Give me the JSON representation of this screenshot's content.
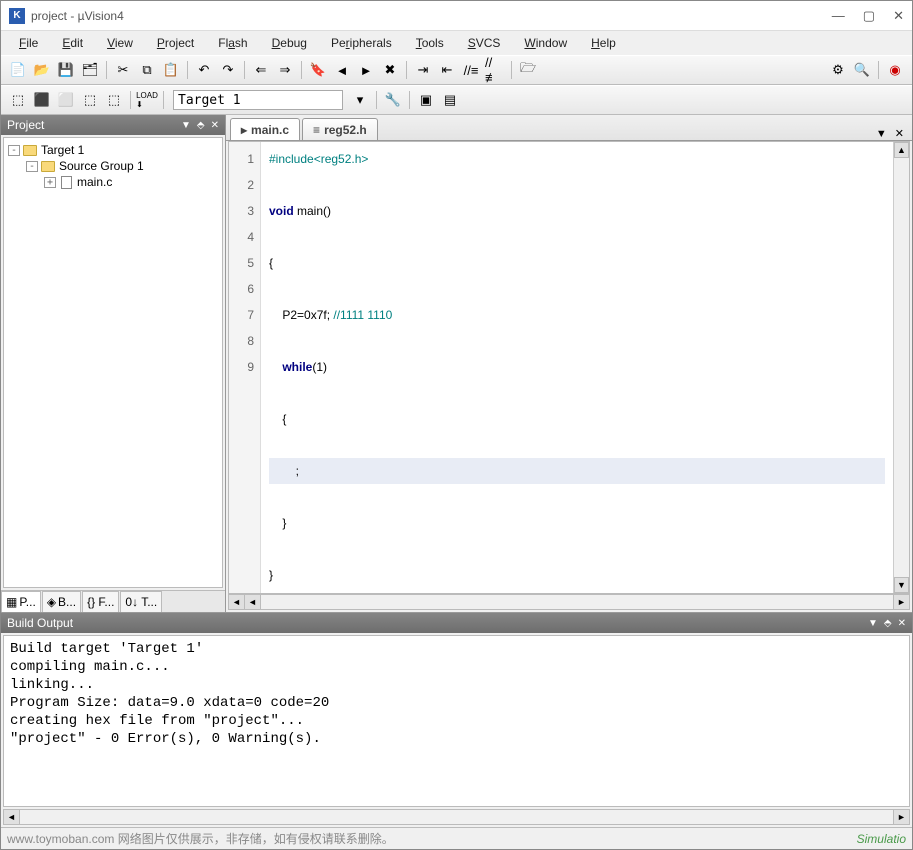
{
  "window": {
    "app_icon": "K",
    "title": "project  - µVision4"
  },
  "menu": [
    "File",
    "Edit",
    "View",
    "Project",
    "Flash",
    "Debug",
    "Peripherals",
    "Tools",
    "SVCS",
    "Window",
    "Help"
  ],
  "toolbar2": {
    "target": "Target 1"
  },
  "project_panel": {
    "title": "Project",
    "tree": {
      "root": "Target 1",
      "group": "Source Group 1",
      "file": "main.c"
    },
    "bottom_tabs": [
      "P...",
      "B...",
      "{} F...",
      "0↓ T..."
    ]
  },
  "editor": {
    "tabs": [
      "main.c",
      "reg52.h"
    ],
    "active_tab": 0,
    "highlighted_line": 7,
    "lines": [
      {
        "n": 1,
        "raw": "#include<reg52.h>",
        "type": "pp"
      },
      {
        "n": 2,
        "raw": "void main()",
        "type": "kw_void_main"
      },
      {
        "n": 3,
        "raw": "{",
        "type": "plain"
      },
      {
        "n": 4,
        "raw": "    P2=0x7f; //1111 1110",
        "type": "assign_comment"
      },
      {
        "n": 5,
        "raw": "    while(1)",
        "type": "kw_while"
      },
      {
        "n": 6,
        "raw": "    {",
        "type": "plain"
      },
      {
        "n": 7,
        "raw": "        ;",
        "type": "plain"
      },
      {
        "n": 8,
        "raw": "    }",
        "type": "plain"
      },
      {
        "n": 9,
        "raw": "}",
        "type": "plain"
      }
    ]
  },
  "build": {
    "title": "Build Output",
    "text": "Build target 'Target 1'\ncompiling main.c...\nlinking...\nProgram Size: data=9.0 xdata=0 code=20\ncreating hex file from \"project\"...\n\"project\" - 0 Error(s), 0 Warning(s)."
  },
  "status": {
    "watermark": "www.toymoban.com 网络图片仅供展示，非存储，如有侵权请联系删除。",
    "mode": "Simulatio"
  }
}
